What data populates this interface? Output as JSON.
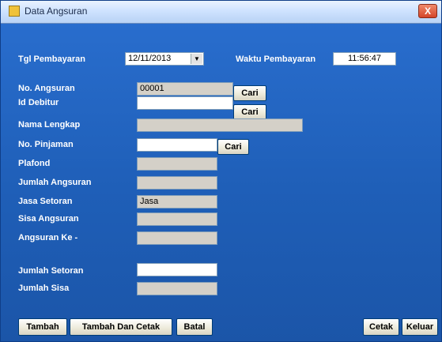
{
  "window": {
    "title": "Data Angsuran",
    "close_label": "X"
  },
  "form": {
    "tgl_pembayaran_label": "Tgl Pembayaran",
    "tgl_pembayaran_value": "12/11/2013",
    "waktu_pembayaran_label": "Waktu Pembayaran",
    "waktu_pembayaran_value": "11:56:47",
    "no_angsuran_label": "No. Angsuran",
    "no_angsuran_value": "00001",
    "id_debitur_label": "Id Debitur",
    "id_debitur_value": "",
    "nama_lengkap_label": "Nama Lengkap",
    "nama_lengkap_value": "",
    "no_pinjaman_label": "No. Pinjaman",
    "no_pinjaman_value": "",
    "plafond_label": "Plafond",
    "plafond_value": "",
    "jumlah_angsuran_label": "Jumlah Angsuran",
    "jumlah_angsuran_value": "",
    "jasa_setoran_label": "Jasa Setoran",
    "jasa_setoran_value": "Jasa",
    "sisa_angsuran_label": "Sisa Angsuran",
    "sisa_angsuran_value": "",
    "angsuran_ke_label": "Angsuran Ke -",
    "angsuran_ke_value": "",
    "jumlah_setoran_label": "Jumlah Setoran",
    "jumlah_setoran_value": "",
    "jumlah_sisa_label": "Jumlah Sisa",
    "jumlah_sisa_value": ""
  },
  "buttons": {
    "cari_1": "Cari",
    "cari_2": "Cari",
    "cari_3": "Cari",
    "tambah": "Tambah",
    "tambah_dan_cetak": "Tambah Dan Cetak",
    "batal": "Batal",
    "cetak": "Cetak",
    "keluar": "Keluar"
  },
  "colors": {
    "background": "#1f5fb8",
    "titlebar": "#cfe3ff",
    "readonly_field": "#d4d0c8"
  }
}
